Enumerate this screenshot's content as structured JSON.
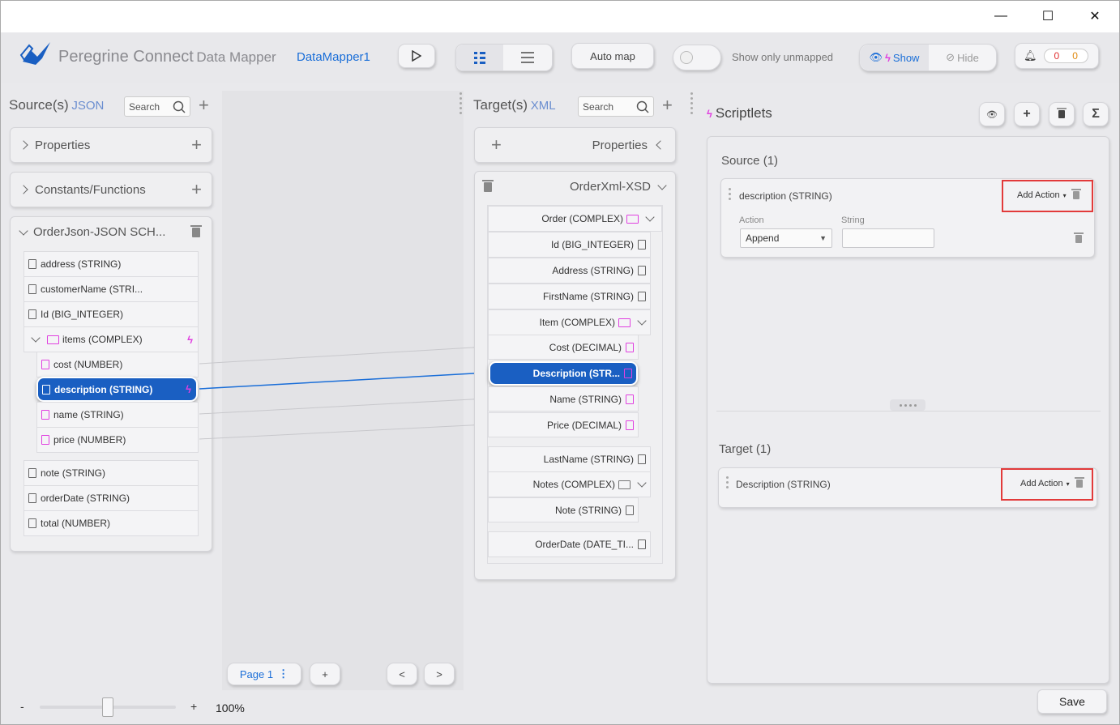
{
  "window": {
    "minimize": "—",
    "maximize": "☐",
    "close": "✕"
  },
  "header": {
    "brand": "Peregrine Connect",
    "module": "Data Mapper",
    "flow_name": "DataMapper1",
    "auto_map": "Auto map",
    "show_only_unmapped": "Show only unmapped",
    "show": "Show",
    "hide": "Hide",
    "errors": "0",
    "warnings": "0"
  },
  "source": {
    "title": "Source(s)",
    "format": "JSON",
    "search_placeholder": "Search",
    "sections": [
      {
        "label": "Properties"
      },
      {
        "label": "Constants/Functions"
      }
    ],
    "doc_title": "OrderJson-JSON SCH...",
    "fields": [
      {
        "label": "address (STRING)"
      },
      {
        "label": "customerName (STRI..."
      },
      {
        "label": "Id (BIG_INTEGER)"
      },
      {
        "label": "items (COMPLEX)"
      },
      {
        "label": "cost (NUMBER)"
      },
      {
        "label": "description (STRING)"
      },
      {
        "label": "name (STRING)"
      },
      {
        "label": "price (NUMBER)"
      },
      {
        "label": "note (STRING)"
      },
      {
        "label": "orderDate (STRING)"
      },
      {
        "label": "total (NUMBER)"
      }
    ]
  },
  "target": {
    "title": "Target(s)",
    "format": "XML",
    "search_placeholder": "Search",
    "properties": "Properties",
    "doc_title": "OrderXml-XSD",
    "fields": [
      {
        "label": "Order (COMPLEX)"
      },
      {
        "label": "Id (BIG_INTEGER)"
      },
      {
        "label": "Address (STRING)"
      },
      {
        "label": "FirstName (STRING)"
      },
      {
        "label": "Item (COMPLEX)"
      },
      {
        "label": "Cost (DECIMAL)"
      },
      {
        "label": "Description (STR..."
      },
      {
        "label": "Name (STRING)"
      },
      {
        "label": "Price (DECIMAL)"
      },
      {
        "label": "LastName (STRING)"
      },
      {
        "label": "Notes (COMPLEX)"
      },
      {
        "label": "Note (STRING)"
      },
      {
        "label": "OrderDate (DATE_TI..."
      }
    ]
  },
  "scriptlets": {
    "title": "Scriptlets",
    "sigma": "Σ",
    "source_header": "Source (1)",
    "source_field": "description (STRING)",
    "add_action": "Add Action",
    "action_label": "Action",
    "action_value": "Append",
    "string_label": "String",
    "string_value": "",
    "target_header": "Target (1)",
    "target_field": "Description (STRING)"
  },
  "footer": {
    "page": "Page 1",
    "add_page": "+",
    "prev": "<",
    "next": ">",
    "zoom_minus": "-",
    "zoom_plus": "+",
    "zoom": "100%",
    "zoom_slider_fraction": 0.5,
    "save": "Save"
  }
}
